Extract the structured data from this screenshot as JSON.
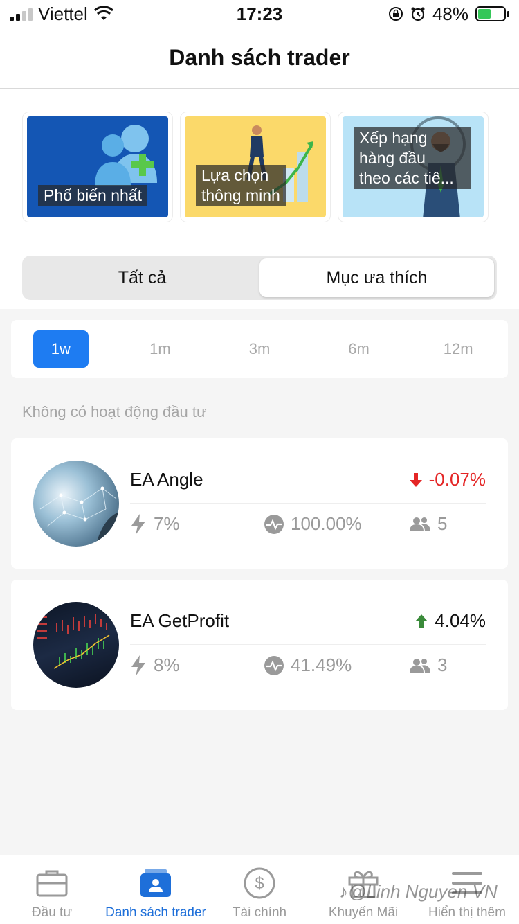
{
  "status_bar": {
    "carrier": "Viettel",
    "time": "17:23",
    "battery": "48%"
  },
  "header": {
    "title": "Danh sách trader"
  },
  "categories": [
    {
      "label_line1": "Phổ biến nhất",
      "label_line2": ""
    },
    {
      "label_line1": "Lựa chọn",
      "label_line2": "thông minh"
    },
    {
      "label_line1": "Xếp hạng",
      "label_line2": "hàng đầu",
      "label_line3": "theo các tiê..."
    }
  ],
  "segment": {
    "all": "Tất cả",
    "favorites": "Mục ưa thích",
    "selected": "favorites"
  },
  "periods": [
    "1w",
    "1m",
    "3m",
    "6m",
    "12m"
  ],
  "selected_period": "1w",
  "empty_message": "Không có hoạt động đầu tư",
  "traders": [
    {
      "name": "EA Angle",
      "change": "-0.07%",
      "direction": "down",
      "risk": "7%",
      "win_rate": "100.00%",
      "followers": "5"
    },
    {
      "name": "EA GetProfit",
      "change": "4.04%",
      "direction": "up",
      "risk": "8%",
      "win_rate": "41.49%",
      "followers": "3"
    }
  ],
  "nav": [
    {
      "label": "Đầu tư",
      "icon": "briefcase-icon"
    },
    {
      "label": "Danh sách trader",
      "icon": "trader-list-icon",
      "active": true
    },
    {
      "label": "Tài chính",
      "icon": "dollar-circle-icon"
    },
    {
      "label": "Khuyến Mãi",
      "icon": "gift-icon"
    },
    {
      "label": "Hiển thị thêm",
      "icon": "menu-icon"
    }
  ],
  "watermark": "@Linh Nguyen VN",
  "colors": {
    "accent": "#1e7cf2",
    "down": "#e42626",
    "up": "#3a8a3a"
  }
}
